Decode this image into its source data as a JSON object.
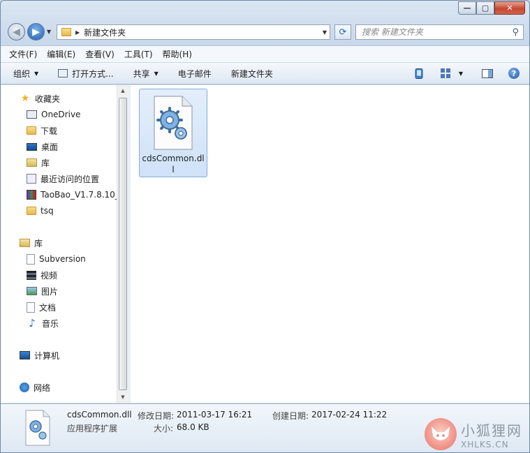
{
  "window": {
    "minimize_label": "—",
    "maximize_label": "▢",
    "close_label": "✕"
  },
  "nav": {
    "back_label": "◀",
    "forward_label": "▶",
    "recent_label": "▼"
  },
  "address": {
    "crumb_arrow": "▶",
    "current_folder": "新建文件夹",
    "dropdown_label": "▼"
  },
  "refresh_label": "⟳",
  "search": {
    "placeholder": "搜索 新建文件夹",
    "icon_label": "⚲"
  },
  "menubar": {
    "file": "文件(F)",
    "edit": "编辑(E)",
    "view": "查看(V)",
    "tools": "工具(T)",
    "help": "帮助(H)"
  },
  "cmdbar": {
    "organize": "组织",
    "open_with": "打开方式...",
    "share": "共享",
    "email": "电子邮件",
    "new_folder": "新建文件夹",
    "dropdown_label": "▼",
    "help_label": "?",
    "views_dropdown": "▼"
  },
  "sidebar": {
    "favorites": {
      "label": "收藏夹",
      "items": [
        "OneDrive",
        "下载",
        "桌面",
        "库",
        "最近访问的位置",
        "TaoBao_V1.7.8.10_",
        "tsq"
      ]
    },
    "libraries": {
      "label": "库",
      "items": [
        "Subversion",
        "视频",
        "图片",
        "文档",
        "音乐"
      ]
    },
    "computer": "计算机",
    "network": "网络"
  },
  "scrollbar": {
    "up_label": "▲",
    "down_label": "▼"
  },
  "files": [
    {
      "name": "cdsCommon.dll"
    }
  ],
  "details": {
    "name": "cdsCommon.dll",
    "type": "应用程序扩展",
    "modified_label": "修改日期:",
    "modified_value": "2011-03-17 16:21",
    "created_label": "创建日期:",
    "created_value": "2017-02-24 11:22",
    "size_label": "大小:",
    "size_value": "68.0 KB"
  },
  "watermark": {
    "title": "小狐狸网",
    "url": "XHLKS.CN"
  },
  "colors": {
    "selection": "#cfe2f8",
    "selection_border": "#84acdd",
    "frame": "#c9d8ea"
  }
}
